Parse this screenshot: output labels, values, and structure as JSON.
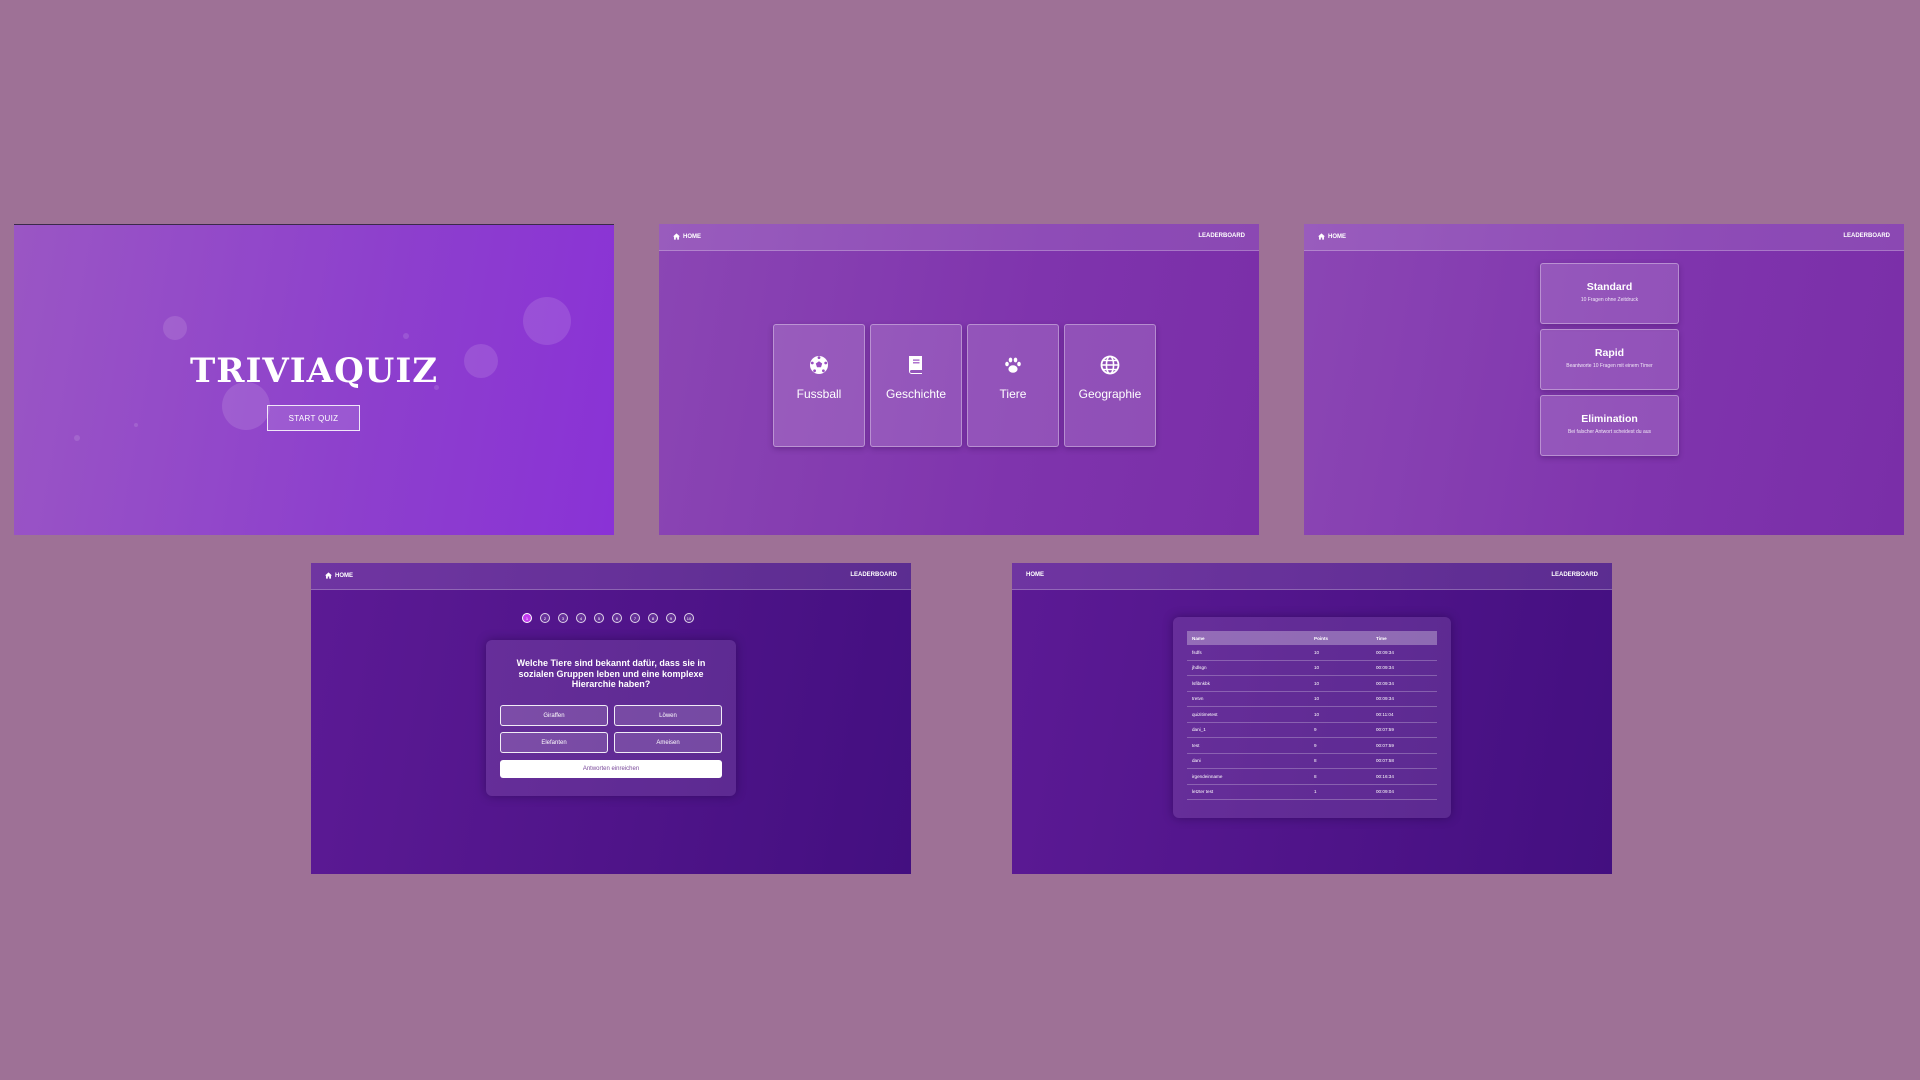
{
  "colors": {
    "page_background": "#9e7196",
    "panel_purple": "#8d3fcd",
    "panel_dark_purple": "#4f1489",
    "active_question": "#c43bf0"
  },
  "home_screen": {
    "title": "TRIVIAQUIZ",
    "start_button": "START QUIZ"
  },
  "nav": {
    "home": "HOME",
    "leaderboard": "LEADERBOARD"
  },
  "categories": [
    {
      "label": "Fussball",
      "icon": "soccer-ball-icon"
    },
    {
      "label": "Geschichte",
      "icon": "book-icon"
    },
    {
      "label": "Tiere",
      "icon": "paw-icon"
    },
    {
      "label": "Geographie",
      "icon": "globe-icon"
    }
  ],
  "modes": [
    {
      "name": "Standard",
      "description": "10 Fragen ohne Zeitdruck"
    },
    {
      "name": "Rapid",
      "description": "Beantworte 10 Fragen mit einem Timer"
    },
    {
      "name": "Elimination",
      "description": "Bei falscher Antwort scheidest du aus"
    }
  ],
  "quiz": {
    "question_numbers": [
      "1",
      "2",
      "3",
      "4",
      "5",
      "6",
      "7",
      "8",
      "9",
      "10"
    ],
    "active_question": "1",
    "question": "Welche Tiere sind bekannt dafür, dass sie in sozialen Gruppen leben und eine komplexe Hierarchie haben?",
    "answers": [
      "Giraffen",
      "Löwen",
      "Elefanten",
      "Ameisen"
    ],
    "submit": "Antworten einreichen"
  },
  "leaderboard": {
    "headers": {
      "name": "Name",
      "points": "Points",
      "time": "Time"
    },
    "rows": [
      {
        "name": "fsdfs",
        "points": "10",
        "time": "00:09:34"
      },
      {
        "name": "jhdlsgn",
        "points": "10",
        "time": "00:09:34"
      },
      {
        "name": "lsfibnkbk",
        "points": "10",
        "time": "00:09:34"
      },
      {
        "name": "tretvn",
        "points": "10",
        "time": "00:09:34"
      },
      {
        "name": "quizitimetest",
        "points": "10",
        "time": "00:11:04"
      },
      {
        "name": "dani_1",
        "points": "9",
        "time": "00:07:59"
      },
      {
        "name": "test",
        "points": "9",
        "time": "00:07:59"
      },
      {
        "name": "dani",
        "points": "8",
        "time": "00:07:58"
      },
      {
        "name": "irgendeinname",
        "points": "8",
        "time": "00:16:34"
      },
      {
        "name": "letzter test",
        "points": "1",
        "time": "00:09:04"
      }
    ]
  }
}
